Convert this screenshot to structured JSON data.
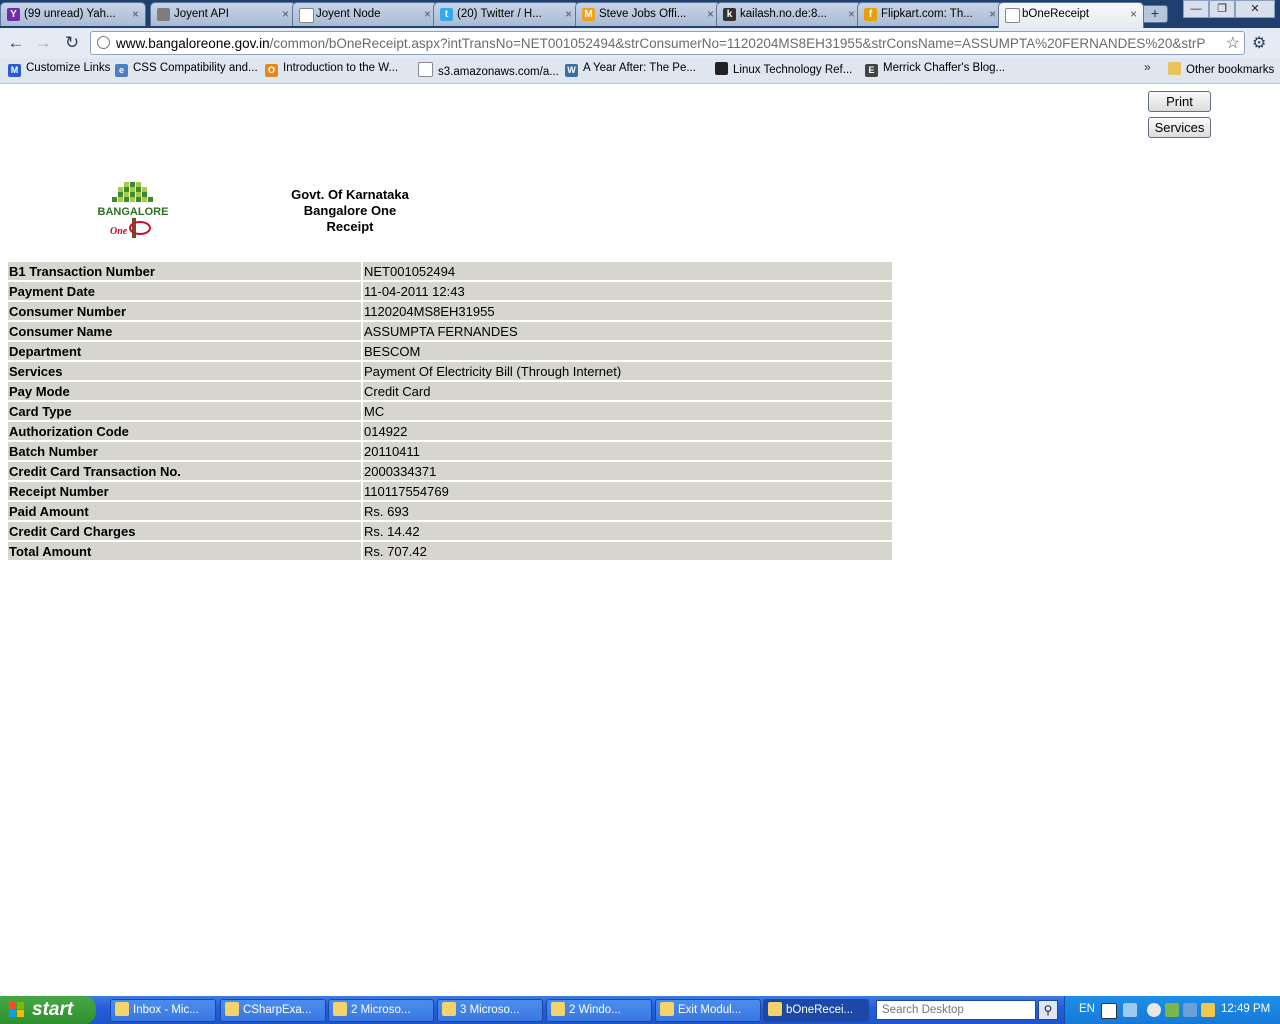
{
  "tabs": [
    {
      "title": "(99 unread) Yah...",
      "icon": "yahoo-icon",
      "color": "#6f2da8",
      "glyph": "Y"
    },
    {
      "title": "Joyent API",
      "icon": "joyent-icon",
      "color": "#7d7d7d",
      "glyph": ""
    },
    {
      "title": "Joyent Node",
      "icon": "page-icon",
      "color": "#ffffff",
      "glyph": ""
    },
    {
      "title": "(20) Twitter / H...",
      "icon": "twitter-icon",
      "color": "#33aaf0",
      "glyph": "t"
    },
    {
      "title": "Steve Jobs Offi...",
      "icon": "m-icon",
      "color": "#f0a020",
      "glyph": "M"
    },
    {
      "title": "kailash.no.de:8...",
      "icon": "circle-icon",
      "color": "#333333",
      "glyph": "k"
    },
    {
      "title": "Flipkart.com: Th...",
      "icon": "flipkart-icon",
      "color": "#e8a000",
      "glyph": "f"
    },
    {
      "title": "bOneReceipt",
      "icon": "page-icon",
      "color": "#ffffff",
      "glyph": ""
    }
  ],
  "address": {
    "host": "www.bangaloreone.gov.in",
    "path": "/common/bOneReceipt.aspx?intTransNo=NET001052494&strConsumerNo=1120204MS8EH31955&strConsName=ASSUMPTA%20FERNANDES%20&strP"
  },
  "bookmarks": [
    {
      "label": "Customize Links",
      "icon": "customize-icon",
      "color": "#2a5bd7",
      "glyph": "M"
    },
    {
      "label": "CSS Compatibility and...",
      "icon": "css-icon",
      "color": "#4a7fc8",
      "glyph": "e"
    },
    {
      "label": "Introduction to the W...",
      "icon": "o-icon",
      "color": "#e08a1e",
      "glyph": "O"
    },
    {
      "label": "s3.amazonaws.com/a...",
      "icon": "page-icon",
      "color": "#ffffff",
      "glyph": ""
    },
    {
      "label": "A Year After: The Pe...",
      "icon": "wordpress-icon",
      "color": "#3c6ea0",
      "glyph": "W"
    },
    {
      "label": "Linux Technology Ref...",
      "icon": "tux-icon",
      "color": "#222222",
      "glyph": ""
    },
    {
      "label": "Merrick Chaffer's Blog...",
      "icon": "emc-icon",
      "color": "#444444",
      "glyph": "E"
    }
  ],
  "other_bookmarks": "Other bookmarks",
  "page": {
    "print_label": "Print",
    "services_label": "Services",
    "heading_lines": [
      "Govt. Of Karnataka",
      "Bangalore One",
      "Receipt"
    ],
    "logo_text": "BANGALORE",
    "logo_sub": "One"
  },
  "receipt": [
    {
      "label": "B1 Transaction Number",
      "value": "NET001052494"
    },
    {
      "label": "Payment Date",
      "value": "11-04-2011 12:43"
    },
    {
      "label": "Consumer Number",
      "value": "1120204MS8EH31955"
    },
    {
      "label": "Consumer Name",
      "value": "ASSUMPTA FERNANDES"
    },
    {
      "label": "Department",
      "value": "BESCOM"
    },
    {
      "label": "Services",
      "value": "Payment Of Electricity Bill (Through Internet)"
    },
    {
      "label": "Pay Mode",
      "value": "Credit Card"
    },
    {
      "label": "Card Type",
      "value": "MC"
    },
    {
      "label": "Authorization Code",
      "value": "014922"
    },
    {
      "label": "Batch Number",
      "value": "20110411"
    },
    {
      "label": "Credit Card Transaction No.",
      "value": "2000334371"
    },
    {
      "label": "Receipt Number",
      "value": "110117554769"
    },
    {
      "label": "Paid Amount",
      "value": "Rs. 693"
    },
    {
      "label": "Credit Card Charges",
      "value": "Rs. 14.42"
    },
    {
      "label": "Total Amount",
      "value": "Rs. 707.42"
    }
  ],
  "taskbar": {
    "start_label": "start",
    "tasks": [
      {
        "label": "Inbox - Mic..."
      },
      {
        "label": "CSharpExa..."
      },
      {
        "label": "2 Microso..."
      },
      {
        "label": "3 Microso..."
      },
      {
        "label": "2 Windo..."
      },
      {
        "label": "Exit Modul..."
      },
      {
        "label": "bOneRecei..."
      }
    ],
    "search_placeholder": "Search Desktop",
    "lang": "EN",
    "clock": "12:49 PM"
  },
  "colors": {
    "row_bg": "#d6d6ce",
    "taskbar": "#245edb",
    "start_green": "#3a9a3a"
  }
}
